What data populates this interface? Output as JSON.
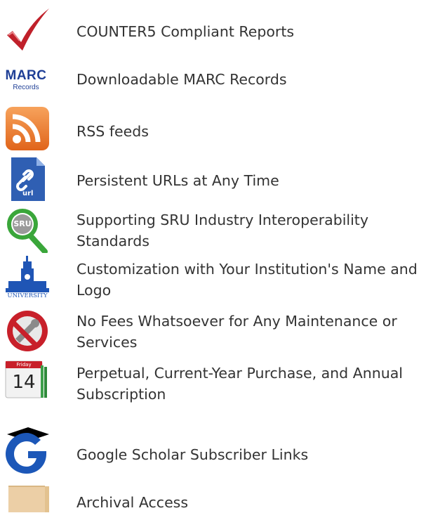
{
  "features": [
    {
      "label": "COUNTER5 Compliant Reports",
      "icon": "checkmark-icon"
    },
    {
      "label": "Downloadable MARC Records",
      "icon": "marc-records-icon",
      "icon_text": {
        "main": "MARC",
        "sub": "Records"
      }
    },
    {
      "label": "RSS feeds",
      "icon": "rss-icon"
    },
    {
      "label": "Persistent URLs at Any Time",
      "icon": "url-link-icon",
      "icon_text": "url"
    },
    {
      "label": "Supporting SRU Industry Interoperability Standards",
      "icon": "sru-magnifier-icon",
      "icon_text": "SRU"
    },
    {
      "label": "Customization with Your Institution's Name and Logo",
      "icon": "university-building-icon",
      "icon_text": "UNIVERSITY"
    },
    {
      "label": "No Fees Whatsoever for Any Maintenance or Services",
      "icon": "no-fees-wrench-icon"
    },
    {
      "label": "Perpetual, Current-Year Purchase, and Annual Subscription",
      "icon": "calendar-icon",
      "icon_text": {
        "day": "Friday",
        "date": "14"
      }
    },
    {
      "label": "Google Scholar Subscriber Links",
      "icon": "google-scholar-icon"
    },
    {
      "label": "Archival Access",
      "icon": "folder-icon"
    }
  ],
  "colors": {
    "text": "#333333",
    "check_red": "#c0202a",
    "marc_blue": "#1f3f96",
    "rss_orange": "#f0781e",
    "url_blue": "#2f5fb3",
    "sru_green": "#3aa63a",
    "no_fees_red": "#c8202a",
    "google_blue": "#1c57b8",
    "folder_tan": "#eccfa6"
  }
}
